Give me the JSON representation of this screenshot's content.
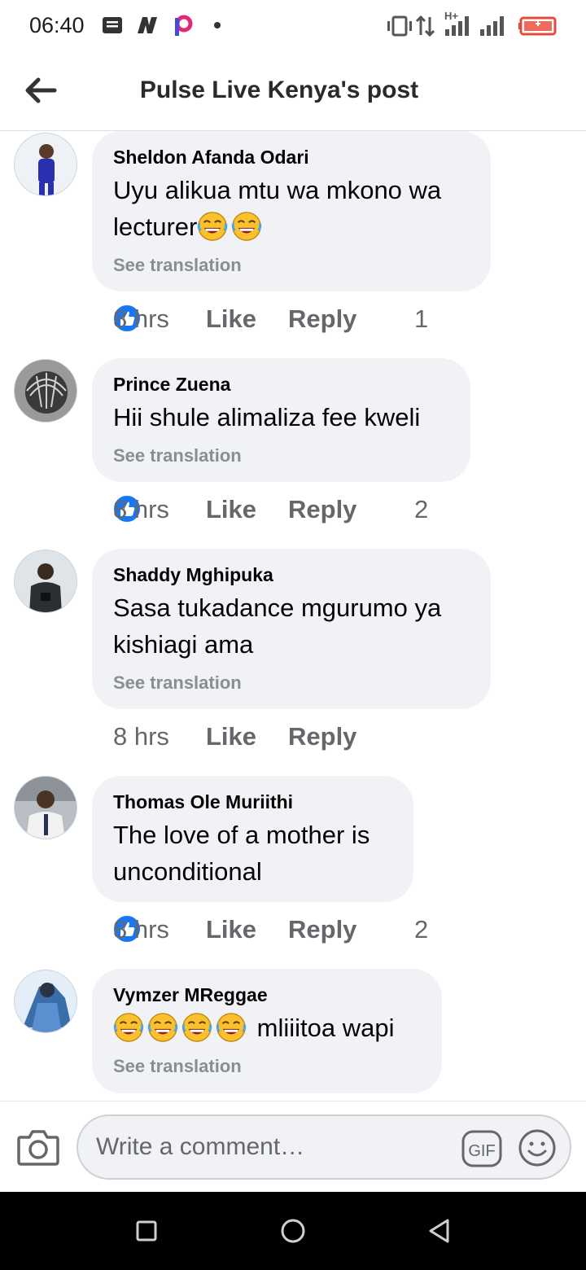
{
  "status_bar": {
    "time": "06:40",
    "network": "H+"
  },
  "header": {
    "title": "Pulse Live Kenya's post",
    "back_icon": "arrow-left-icon"
  },
  "comments": [
    {
      "name": "Sheldon Afanda Odari",
      "text_lines": [
        "Uyu alikua mtu wa mkono wa",
        "lecturer"
      ],
      "emoji_count": 2,
      "see_translation": "See translation",
      "time": "8 hrs",
      "like": "Like",
      "reply": "Reply",
      "reactions": "1"
    },
    {
      "name": "Prince Zuena",
      "text_lines": [
        "Hii shule alimaliza fee kweli"
      ],
      "see_translation": "See translation",
      "time": "8 hrs",
      "like": "Like",
      "reply": "Reply",
      "reactions": "2"
    },
    {
      "name": "Shaddy Mghipuka",
      "text_lines": [
        "Sasa tukadance mgurumo ya",
        "kishiagi ama"
      ],
      "see_translation": "See translation",
      "time": "8 hrs",
      "like": "Like",
      "reply": "Reply"
    },
    {
      "name": "Thomas Ole Muriithi",
      "text_lines": [
        "The love of a mother is",
        "unconditional"
      ],
      "time": "8 hrs",
      "like": "Like",
      "reply": "Reply",
      "reactions": "2"
    },
    {
      "name": "Vymzer MReggae",
      "text": "mliiitoa wapi",
      "emoji_count": 4,
      "see_translation": "See translation"
    }
  ],
  "composer": {
    "placeholder": "Write a comment…",
    "camera_icon": "camera-icon",
    "gif_label": "GIF",
    "emoji_icon": "smiley-icon"
  },
  "colors": {
    "bubble": "#f0f2f5",
    "meta": "#65676b",
    "like_blue": "#1877f2",
    "see_translation": "#8a8d91"
  }
}
